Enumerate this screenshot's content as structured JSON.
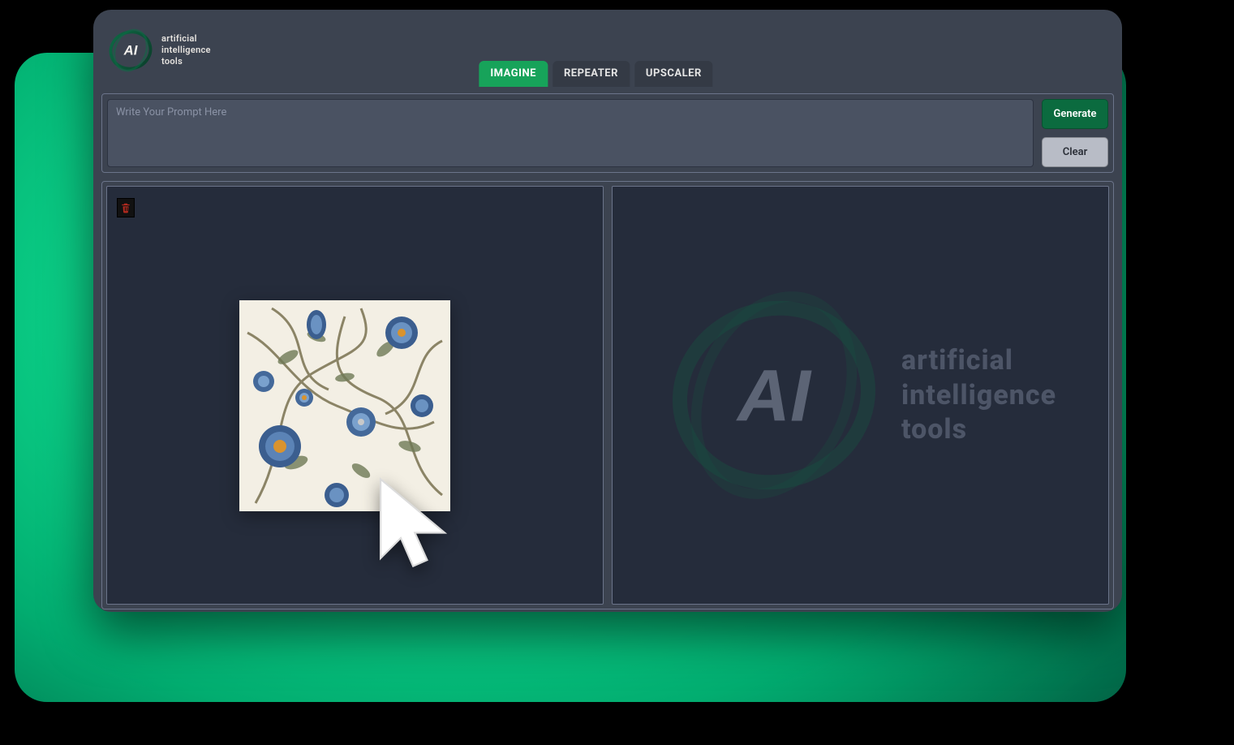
{
  "brand": {
    "mark": "AI",
    "tagline_lines": [
      "artificial",
      "intelligence",
      "tools"
    ]
  },
  "tabs": [
    {
      "label": "IMAGINE",
      "active": true
    },
    {
      "label": "REPEATER",
      "active": false
    },
    {
      "label": "UPSCALER",
      "active": false
    }
  ],
  "prompt": {
    "placeholder": "Write Your Prompt Here",
    "value": ""
  },
  "buttons": {
    "generate": "Generate",
    "clear": "Clear"
  },
  "watermark": {
    "mark": "AI",
    "tagline_lines": [
      "artificial",
      "intelligence",
      "tools"
    ]
  },
  "icons": {
    "trash": "trash-icon",
    "cursor": "cursor-pointer-icon"
  },
  "colors": {
    "accent_green": "#17a35a",
    "generate_green": "#0b6b3f",
    "panel_bg": "#252c3b",
    "app_bg": "#3c4350"
  }
}
